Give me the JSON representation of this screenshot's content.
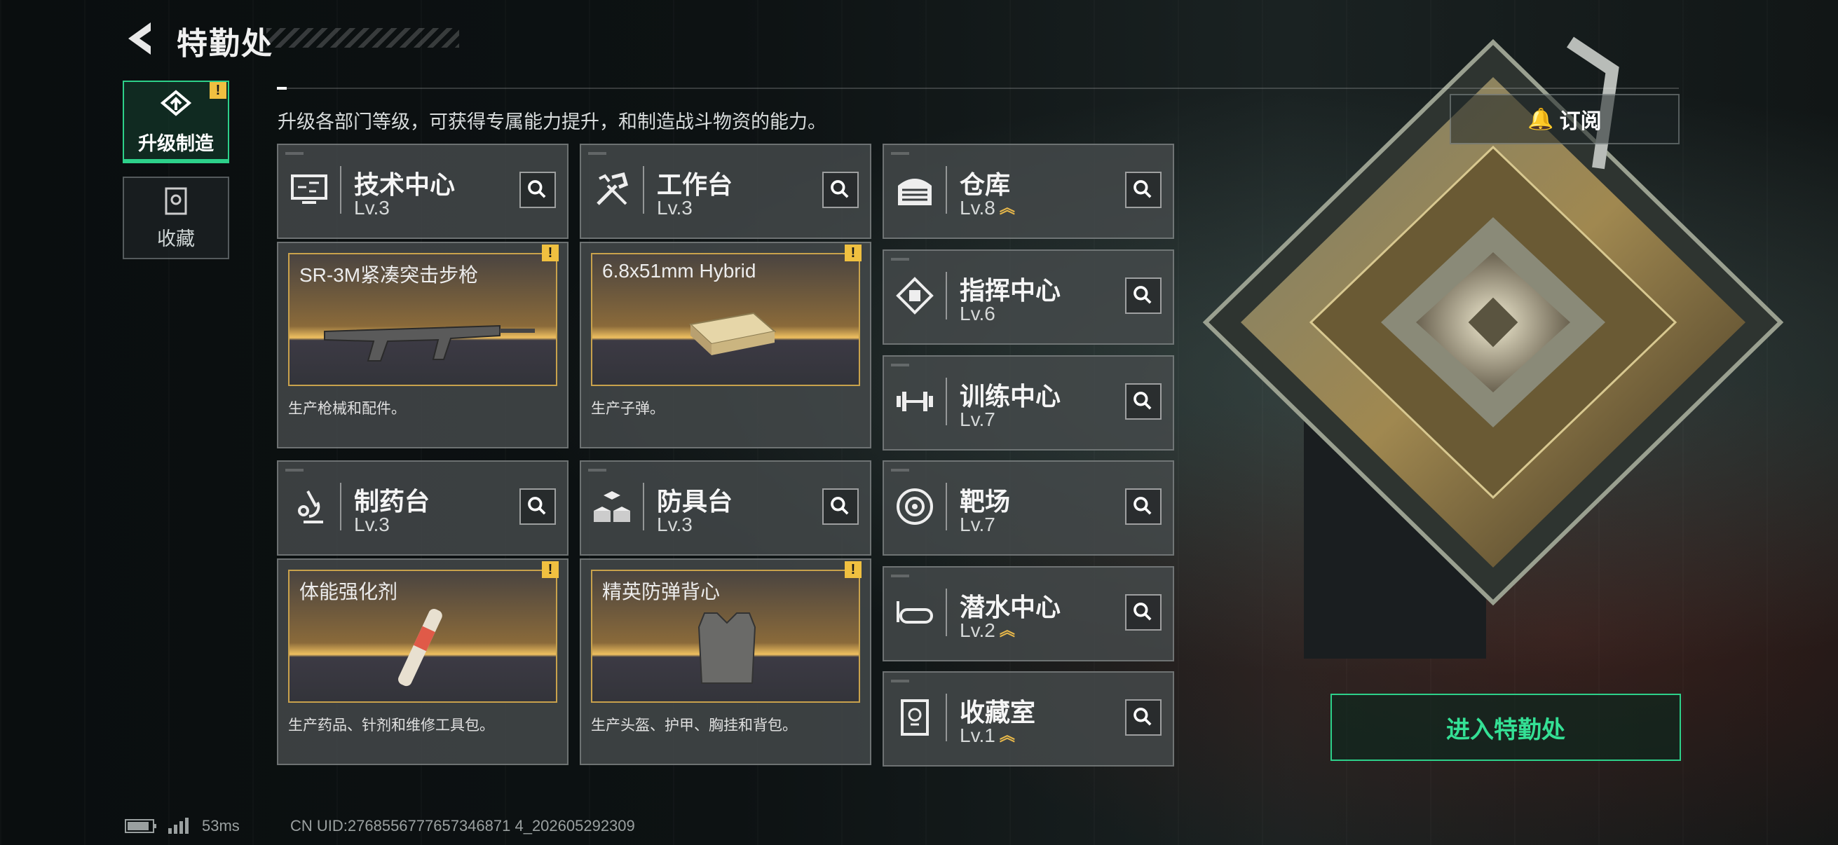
{
  "header": {
    "title": "特勤处"
  },
  "nav": [
    {
      "label": "升级制造",
      "active": true
    },
    {
      "label": "收藏",
      "active": false
    }
  ],
  "subtitle": "升级各部门等级，可获得专属能力提升，和制造战斗物资的能力。",
  "subscribe_label": "订阅",
  "warn_mark": "!",
  "workshops_left": [
    {
      "name": "技术中心",
      "level": "Lv.3",
      "icon": "monitor-icon",
      "product": {
        "name": "SR-3M紧凑突击步枪",
        "desc": "生产枪械和配件。",
        "image": "rifle-icon"
      }
    },
    {
      "name": "工作台",
      "level": "Lv.3",
      "icon": "tools-icon",
      "product": {
        "name": "6.8x51mm Hybrid",
        "desc": "生产子弹。",
        "image": "ammo-box-icon"
      }
    },
    {
      "name": "制药台",
      "level": "Lv.3",
      "icon": "microscope-icon",
      "product": {
        "name": "体能强化剂",
        "desc": "生产药品、针剂和维修工具包。",
        "image": "injector-icon"
      }
    },
    {
      "name": "防具台",
      "level": "Lv.3",
      "icon": "cubes-icon",
      "product": {
        "name": "精英防弹背心",
        "desc": "生产头盔、护甲、胸挂和背包。",
        "image": "vest-icon"
      }
    }
  ],
  "workshops_right": [
    {
      "name": "仓库",
      "level": "Lv.8",
      "upgradable": true,
      "icon": "warehouse-icon"
    },
    {
      "name": "指挥中心",
      "level": "Lv.6",
      "upgradable": false,
      "icon": "chip-icon"
    },
    {
      "name": "训练中心",
      "level": "Lv.7",
      "upgradable": false,
      "icon": "dumbbell-icon"
    },
    {
      "name": "靶场",
      "level": "Lv.7",
      "upgradable": false,
      "icon": "target-icon"
    },
    {
      "name": "潜水中心",
      "level": "Lv.2",
      "upgradable": true,
      "icon": "goggles-icon"
    },
    {
      "name": "收藏室",
      "level": "Lv.1",
      "upgradable": true,
      "icon": "trophy-icon"
    }
  ],
  "enter_label": "进入特勤处",
  "status": {
    "ping": "53ms",
    "uid": "CN UID:2768556777657346871 4_202605292309"
  },
  "colors": {
    "accent": "#2dd08a",
    "warning": "#f0c040",
    "gold": "#c9a24c"
  }
}
